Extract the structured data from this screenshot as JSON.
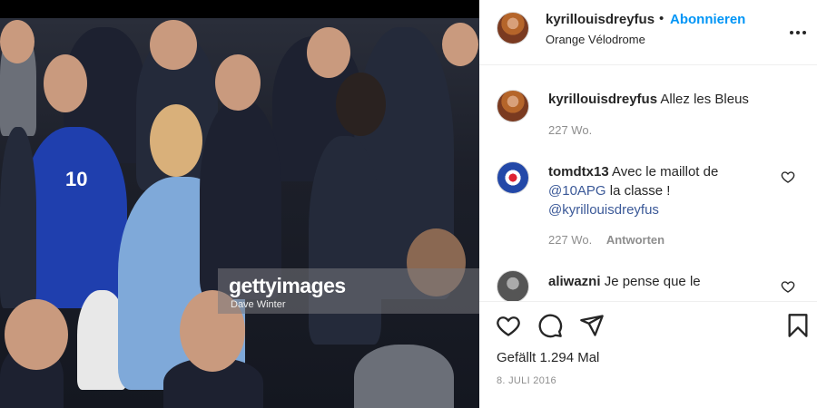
{
  "photo": {
    "watermark_brand": "gettyimages",
    "watermark_credit": "Dave Winter"
  },
  "header": {
    "username": "kyrillouisdreyfus",
    "separator": "•",
    "follow_label": "Abonnieren",
    "location": "Orange Vélodrome",
    "more_icon": "more-horizontal-icon"
  },
  "comments": [
    {
      "username": "kyrillouisdreyfus",
      "text": "Allez les Bleus",
      "age": "227 Wo."
    },
    {
      "username": "tomdtx13",
      "text_line1": "Avec le maillot de",
      "mention1": "@10APG",
      "text_line2": "la classe !",
      "mention2": "@kyrillouisdreyfus",
      "age": "227 Wo.",
      "reply_label": "Antworten"
    },
    {
      "username": "aliwazni",
      "text": "Je pense que le"
    }
  ],
  "actions": {
    "icons": [
      "heart-icon",
      "comment-icon",
      "share-icon",
      "bookmark-icon"
    ],
    "likes": "Gefällt 1.294 Mal",
    "date": "8. JULI 2016"
  },
  "colors": {
    "follow": "#0095f6",
    "link": "#3b5998",
    "muted": "#8e8e8e"
  }
}
